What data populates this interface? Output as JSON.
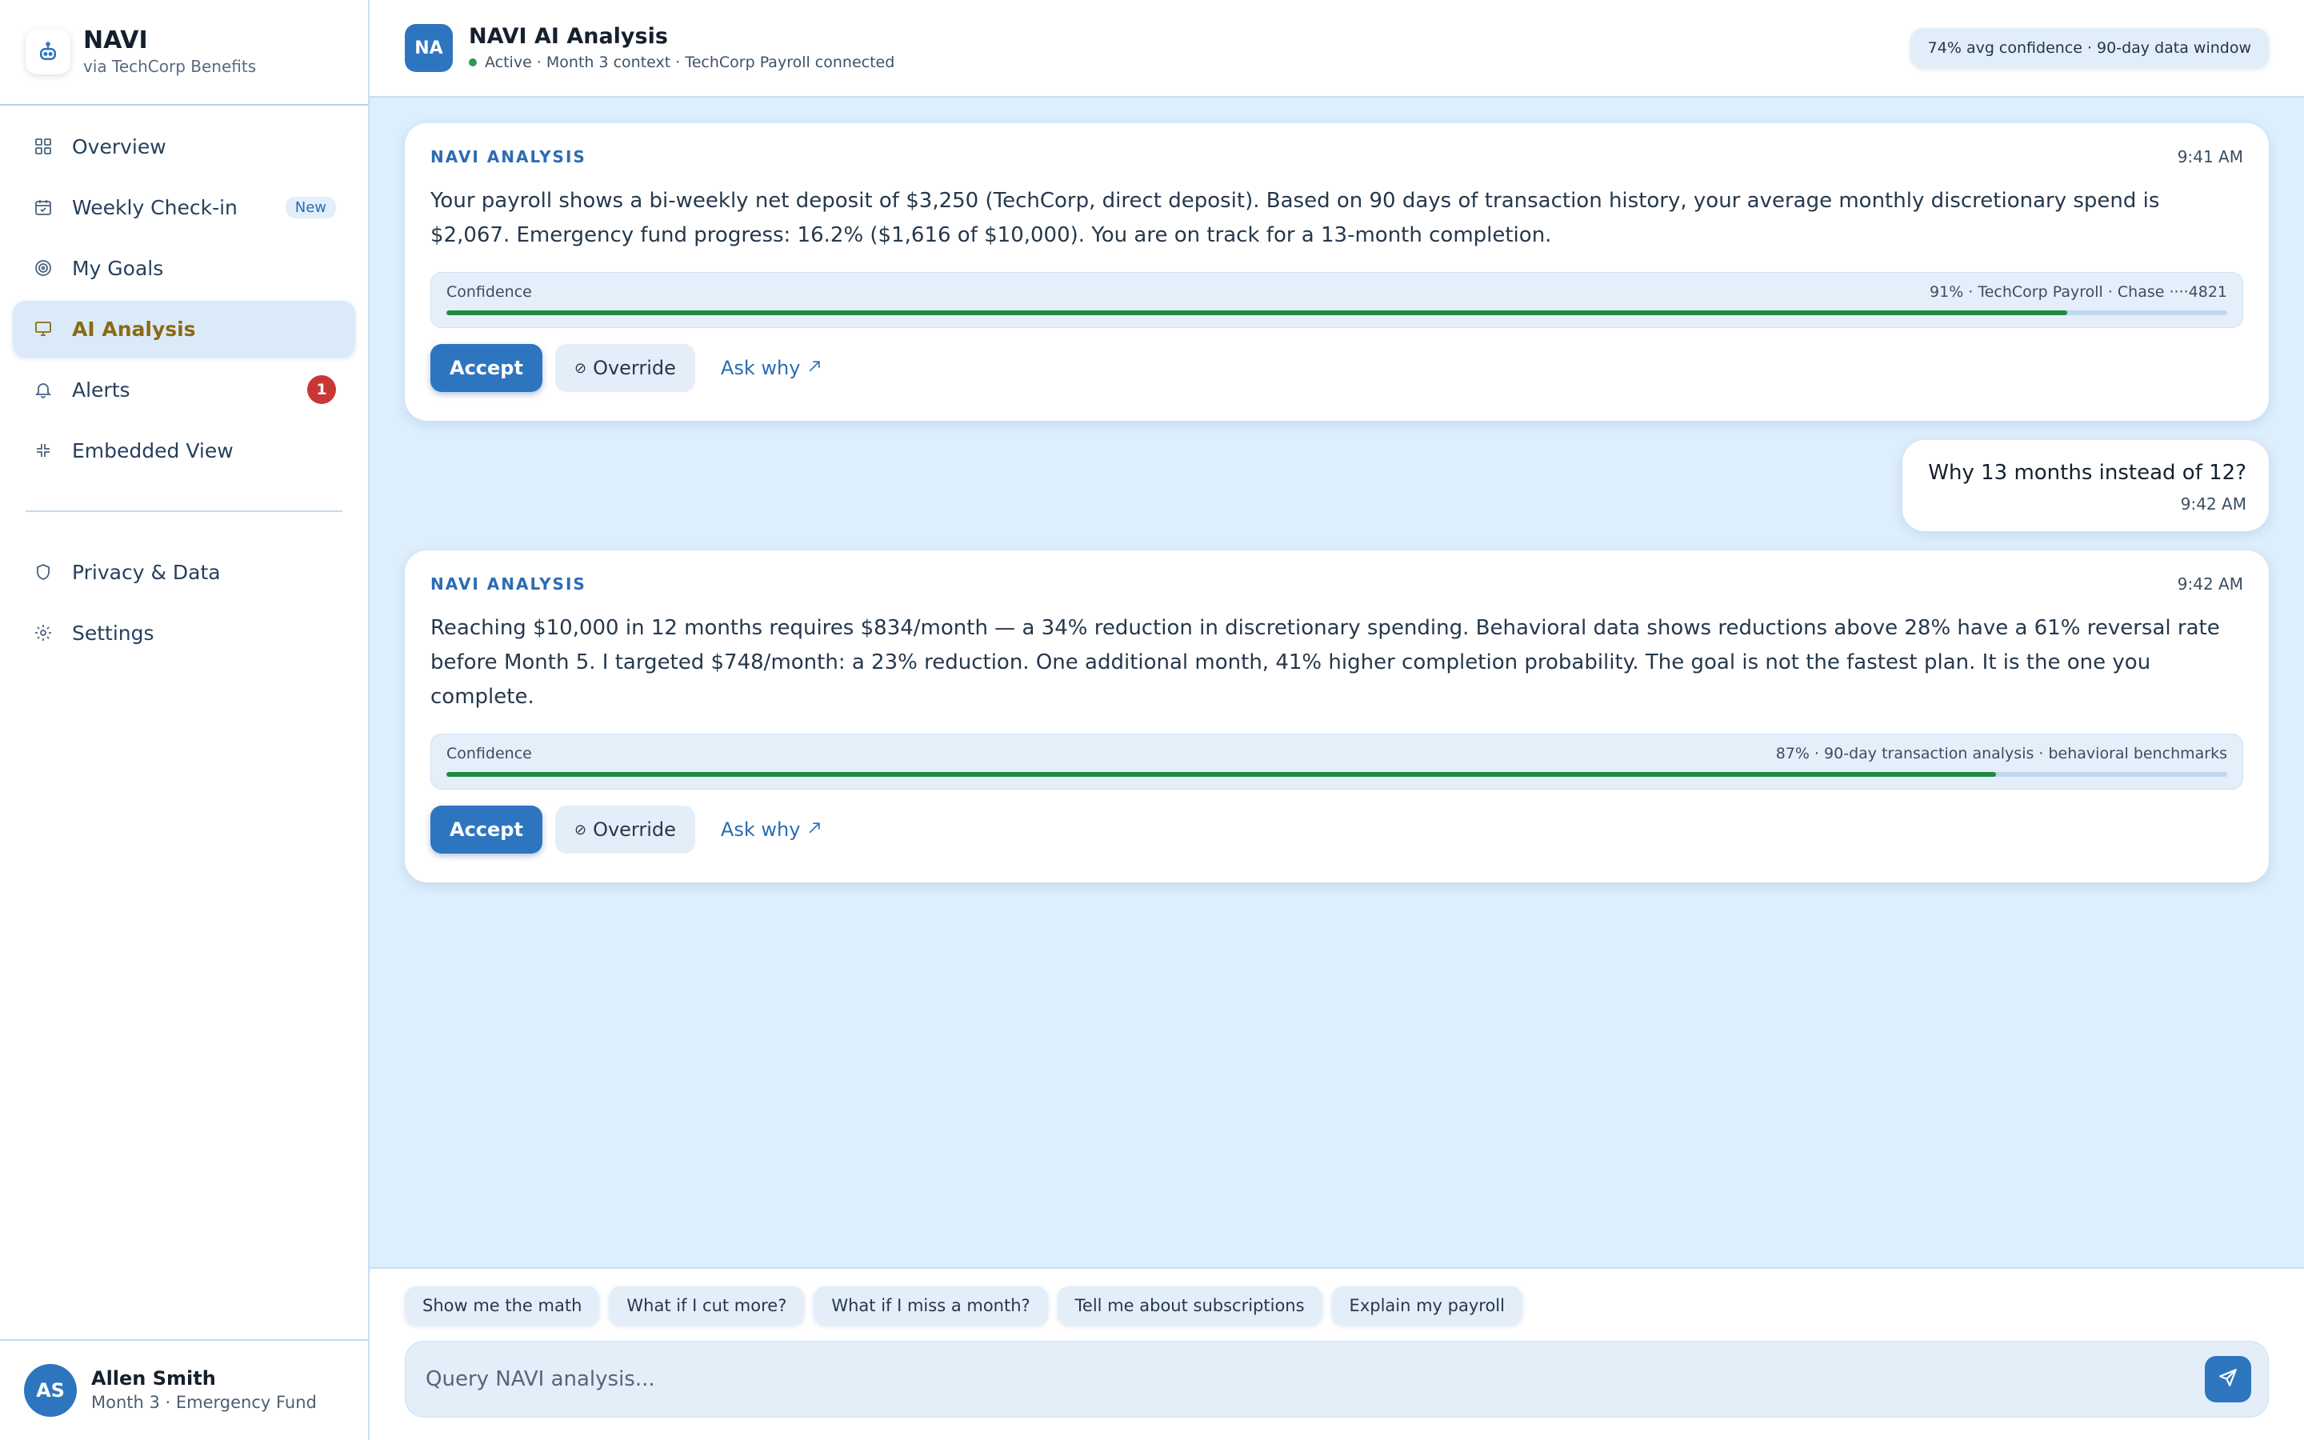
{
  "brand": {
    "title": "NAVI",
    "subtitle": "via TechCorp Benefits"
  },
  "nav": {
    "items": [
      {
        "label": "Overview",
        "icon": "grid-icon"
      },
      {
        "label": "Weekly Check-in",
        "icon": "calendar-icon",
        "badge": "New"
      },
      {
        "label": "My Goals",
        "icon": "target-icon"
      },
      {
        "label": "AI Analysis",
        "icon": "monitor-icon",
        "active": true
      },
      {
        "label": "Alerts",
        "icon": "bell-icon",
        "count": "1"
      },
      {
        "label": "Embedded View",
        "icon": "collapse-icon"
      }
    ],
    "secondary": [
      {
        "label": "Privacy & Data",
        "icon": "shield-icon"
      },
      {
        "label": "Settings",
        "icon": "gear-icon"
      }
    ]
  },
  "user": {
    "initials": "AS",
    "name": "Allen Smith",
    "context": "Month 3 · Emergency Fund"
  },
  "header": {
    "initials": "NA",
    "title": "NAVI AI Analysis",
    "status": "Active · Month 3 context · TechCorp Payroll connected",
    "pill": "74% avg confidence · 90-day data window"
  },
  "messages": [
    {
      "label": "NAVI ANALYSIS",
      "time": "9:41 AM",
      "body": "Your payroll shows a bi-weekly net deposit of $3,250 (TechCorp, direct deposit). Based on 90 days of transaction history, your average monthly discretionary spend is $2,067. Emergency fund progress: 16.2% ($1,616 of $10,000). You are on track for a 13-month completion.",
      "confidence_label": "Confidence",
      "confidence_detail": "91% · TechCorp Payroll · Chase ····4821",
      "confidence_value": 0.91,
      "accept": "Accept",
      "override": "Override",
      "ask": "Ask why"
    },
    {
      "user_text": "Why 13 months instead of 12?",
      "time": "9:42 AM"
    },
    {
      "label": "NAVI ANALYSIS",
      "time": "9:42 AM",
      "body": "Reaching $10,000 in 12 months requires $834/month — a 34% reduction in discretionary spending. Behavioral data shows reductions above 28% have a 61% reversal rate before Month 5. I targeted $748/month: a 23% reduction. One additional month, 41% higher completion probability. The goal is not the fastest plan. It is the one you complete.",
      "confidence_label": "Confidence",
      "confidence_detail": "87% · 90-day transaction analysis · behavioral benchmarks",
      "confidence_value": 0.87,
      "accept": "Accept",
      "override": "Override",
      "ask": "Ask why"
    }
  ],
  "suggestions": [
    "Show me the math",
    "What if I cut more?",
    "What if I miss a month?",
    "Tell me about subscriptions",
    "Explain my payroll"
  ],
  "composer": {
    "placeholder": "Query NAVI analysis..."
  },
  "colors": {
    "accent": "#2e75c0",
    "active_label": "#8a6a12",
    "confidence_fill": "#1f8a3f",
    "alert": "#c83636"
  }
}
